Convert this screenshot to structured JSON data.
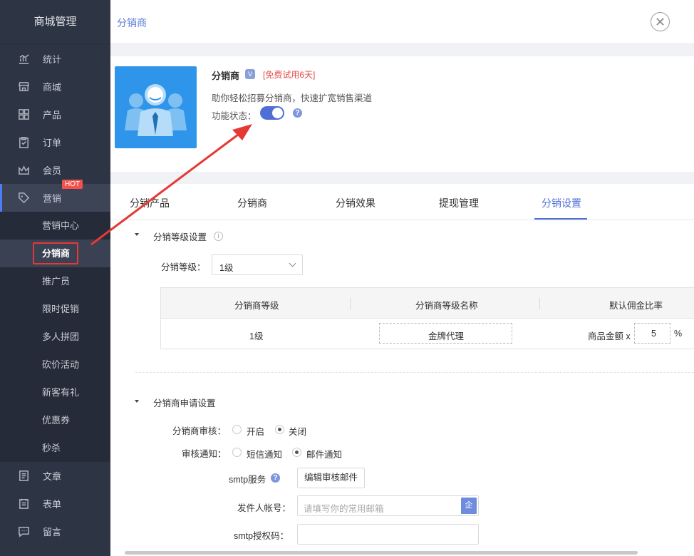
{
  "sidebar": {
    "title": "商城管理",
    "items": [
      {
        "label": "统计",
        "icon": "chart-icon"
      },
      {
        "label": "商城",
        "icon": "store-icon"
      },
      {
        "label": "产品",
        "icon": "grid-icon"
      },
      {
        "label": "订单",
        "icon": "clipboard-icon"
      },
      {
        "label": "会员",
        "icon": "crown-icon"
      },
      {
        "label": "营销",
        "icon": "tag-icon",
        "badge": "HOT"
      }
    ],
    "submenu": [
      "营销中心",
      "分销商",
      "推广员",
      "限时促销",
      "多人拼团",
      "砍价活动",
      "新客有礼",
      "优惠券",
      "秒杀"
    ],
    "bottom_items": [
      {
        "label": "文章",
        "icon": "article-icon"
      },
      {
        "label": "表单",
        "icon": "form-icon"
      },
      {
        "label": "留言",
        "icon": "message-icon"
      }
    ]
  },
  "header": {
    "title": "分销商"
  },
  "plugin": {
    "name": "分销商",
    "badge": "VIP",
    "trial": "[免费试用6天]",
    "description": "助你轻松招募分销商，快速扩宽销售渠道",
    "state_label": "功能状态："
  },
  "tabs": [
    "分销产品",
    "分销商",
    "分销效果",
    "提现管理",
    "分销设置"
  ],
  "level_section": {
    "title": "分销等级设置",
    "level_label": "分销等级：",
    "level_value": "1级",
    "table": {
      "headers": [
        "分销商等级",
        "分销商等级名称",
        "默认佣金比率"
      ],
      "row": {
        "level": "1级",
        "name": "金牌代理",
        "commission_prefix": "商品金额 x",
        "commission_value": "5",
        "commission_unit": "%"
      }
    }
  },
  "apply_section": {
    "title": "分销商申请设置",
    "review_label": "分销商审核：",
    "review_options": [
      "开启",
      "关闭"
    ],
    "notify_label": "审核通知：",
    "notify_options": [
      "短信通知",
      "邮件通知"
    ],
    "smtp_label": "smtp服务",
    "smtp_button": "编辑审核邮件",
    "sender_label": "发件人帐号：",
    "sender_placeholder": "请填写你的常用邮箱",
    "sender_btn": "企",
    "auth_label": "smtp授权码："
  },
  "colors": {
    "accent": "#4f6fd6",
    "sidebar_bg": "#2d3444",
    "hot": "#f2524c",
    "annotation": "#e53935"
  }
}
